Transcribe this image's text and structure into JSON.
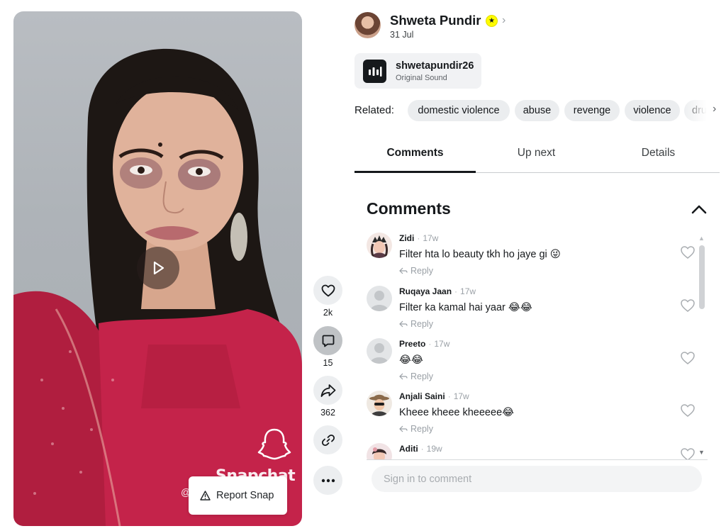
{
  "video": {
    "watermark_text": "Snapchat",
    "watermark_handle": "@",
    "report_label": "Report Snap"
  },
  "actions": {
    "likes": "2k",
    "comments": "15",
    "shares": "362"
  },
  "creator": {
    "name": "Shweta Pundir",
    "date": "31 Jul"
  },
  "sound": {
    "name": "shwetapundir26",
    "subtitle": "Original Sound"
  },
  "related": {
    "label": "Related:",
    "chips": [
      "domestic violence",
      "abuse",
      "revenge",
      "violence",
      "dru"
    ]
  },
  "tabs": [
    "Comments",
    "Up next",
    "Details"
  ],
  "comments_section": {
    "heading": "Comments",
    "reply_label": "Reply",
    "items": [
      {
        "user": "Zidi",
        "time": "17w",
        "text": "Filter hta lo beauty tkh ho jaye gi 😜"
      },
      {
        "user": "Ruqaya Jaan",
        "time": "17w",
        "text": "Filter ka kamal hai yaar 😂😂"
      },
      {
        "user": "Preeto",
        "time": "17w",
        "text": "😂😂"
      },
      {
        "user": "Anjali Saini",
        "time": "17w",
        "text": "Kheee kheee kheeeee😂"
      },
      {
        "user": "Aditi",
        "time": "19w",
        "text": ""
      }
    ],
    "input_placeholder": "Sign in to comment"
  },
  "colors": {
    "badge_yellow": "#fffc00",
    "text_primary": "#16191c",
    "muted": "#9aa0a6"
  }
}
